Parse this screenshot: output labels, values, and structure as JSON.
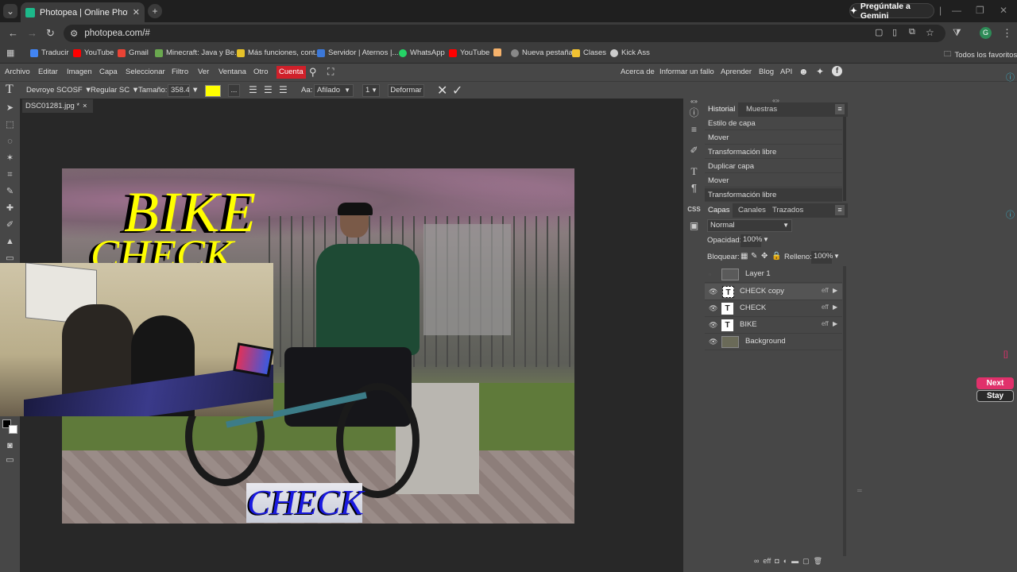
{
  "browser": {
    "tab_title": "Photopea | Online Photo Editor",
    "new_tab": "+",
    "gemini_label": "Pregúntale a Gemini",
    "url": "photopea.com/#",
    "profile_initial": "G",
    "bookmarks": [
      {
        "label": "Traducir",
        "color": "#4285f4"
      },
      {
        "label": "YouTube",
        "color": "#ff0000"
      },
      {
        "label": "Gmail",
        "color": "#ea4335"
      },
      {
        "label": "Minecraft: Java y Be...",
        "color": "#6aa84f"
      },
      {
        "label": "Más funciones, cont...",
        "color": "#e6c229"
      },
      {
        "label": "Servidor | Aternos |...",
        "color": "#3c78d8"
      },
      {
        "label": "WhatsApp",
        "color": "#25d366"
      },
      {
        "label": "YouTube",
        "color": "#ff0000"
      },
      {
        "label": "",
        "color": "#f6b26b"
      },
      {
        "label": "Nueva pestaña",
        "color": "#888888"
      },
      {
        "label": "Clases",
        "color": "#f1c232"
      },
      {
        "label": "Kick Ass",
        "color": "#cccccc"
      }
    ],
    "all_bookmarks": "Todos los favoritos"
  },
  "menu": {
    "items": [
      "Archivo",
      "Editar",
      "Imagen",
      "Capa",
      "Seleccionar",
      "Filtro",
      "Ver",
      "Ventana",
      "Otro"
    ],
    "cuenta": "Cuenta",
    "right_links": [
      "Acerca de",
      "Informar un fallo",
      "Aprender",
      "Blog",
      "API"
    ]
  },
  "options": {
    "font_family": "Devroye SCOSF",
    "font_style": "Regular SC",
    "size_label": "Tamaño:",
    "size_value": "358.4t",
    "color_swatch": "#ffff00",
    "more": "...",
    "aa_label": "Aa:",
    "aa_value": "Afilado",
    "leading_value": "1",
    "warp_label": "Deformar"
  },
  "document": {
    "tab_label": "DSC01281.jpg *",
    "close": "×",
    "text_bike": "BIKE",
    "text_check_top": "CHECK",
    "text_check_bottom": "CHECK"
  },
  "history": {
    "tabs": [
      "Historial",
      "Muestras"
    ],
    "items": [
      "Estilo de capa",
      "Mover",
      "Transformación libre",
      "Duplicar capa",
      "Mover",
      "Transformación libre"
    ]
  },
  "layers": {
    "tabs": [
      "Capas",
      "Canales",
      "Trazados"
    ],
    "blend_mode": "Normal",
    "opacity_label": "Opacidad:",
    "opacity_value": "100%",
    "lock_label": "Bloquear:",
    "fill_label": "Relleno:",
    "fill_value": "100%",
    "rows": [
      {
        "name": "Layer 1",
        "type": "image",
        "visible": false,
        "fx": ""
      },
      {
        "name": "CHECK copy",
        "type": "text",
        "visible": true,
        "fx": "eff"
      },
      {
        "name": "CHECK",
        "type": "text",
        "visible": true,
        "fx": "eff"
      },
      {
        "name": "BIKE",
        "type": "text",
        "visible": true,
        "fx": "eff"
      },
      {
        "name": "Background",
        "type": "image",
        "visible": true,
        "fx": ""
      }
    ]
  },
  "ad": {
    "next": "Next",
    "stay": "Stay"
  }
}
